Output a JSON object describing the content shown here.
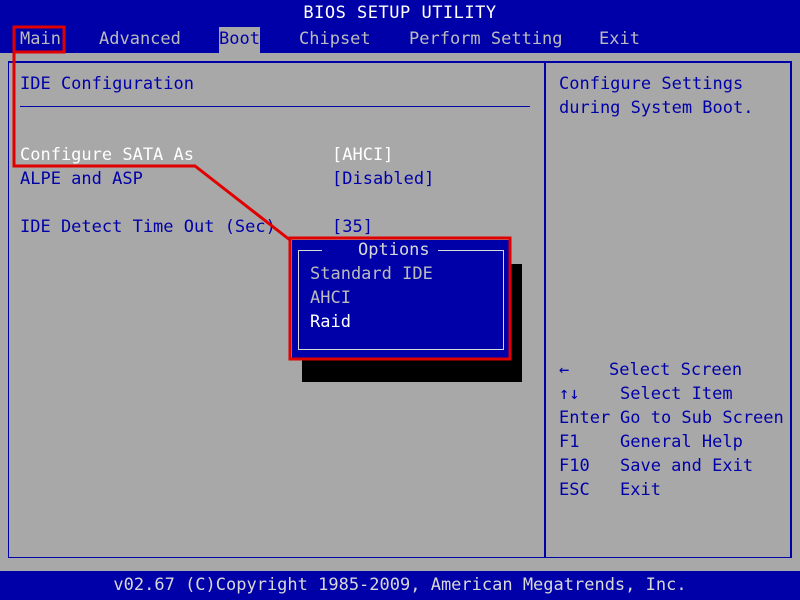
{
  "title": "BIOS SETUP UTILITY",
  "menu": [
    {
      "key": "main",
      "label": "Main"
    },
    {
      "key": "advanced",
      "label": "Advanced"
    },
    {
      "key": "boot",
      "label": "Boot"
    },
    {
      "key": "chipset",
      "label": "Chipset"
    },
    {
      "key": "perform",
      "label": "Perform Setting"
    },
    {
      "key": "exit",
      "label": "Exit"
    }
  ],
  "section_title": "IDE Configuration",
  "settings": [
    {
      "label": "Configure SATA As",
      "value": "[AHCI]"
    },
    {
      "label": "ALPE and ASP",
      "value": "[Disabled]"
    },
    {
      "label": "IDE Detect Time Out (Sec)",
      "value": "[35]"
    }
  ],
  "help_text": [
    "Configure Settings",
    "during System Boot."
  ],
  "keys": [
    {
      "key": "←",
      "desc": "Select Screen"
    },
    {
      "key": "↑↓",
      "desc": "Select Item"
    },
    {
      "key": "Enter",
      "desc": "Go to Sub Screen"
    },
    {
      "key": "F1",
      "desc": "General Help"
    },
    {
      "key": "F10",
      "desc": "Save and Exit"
    },
    {
      "key": "ESC",
      "desc": "Exit"
    }
  ],
  "popup": {
    "title": "Options",
    "options": [
      "Standard IDE",
      "AHCI",
      "Raid"
    ]
  },
  "footer": "v02.67 (C)Copyright 1985-2009, American Megatrends, Inc.",
  "colors": {
    "bios_blue": "#0000a8",
    "bios_gray": "#a8a8a8",
    "annotation_red": "#e00000"
  }
}
